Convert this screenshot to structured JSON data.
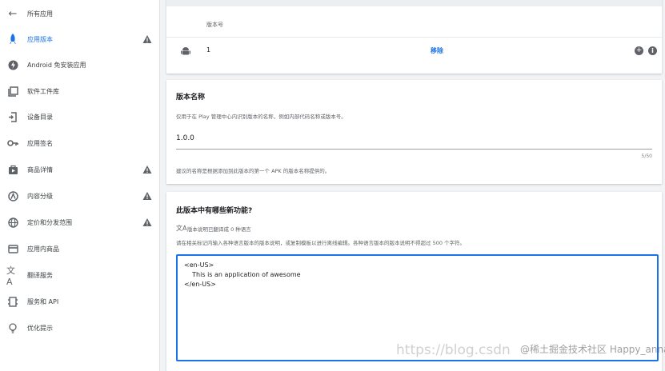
{
  "sidebar": {
    "items": [
      {
        "label": "所有应用",
        "icon": "arrow-back-icon"
      },
      {
        "label": "应用版本",
        "icon": "rocket-icon",
        "active": true,
        "warning": true
      },
      {
        "label": "Android 免安装应用",
        "icon": "instant-app-icon"
      },
      {
        "label": "软件工件库",
        "icon": "library-icon"
      },
      {
        "label": "设备目录",
        "icon": "device-catalog-icon"
      },
      {
        "label": "应用签名",
        "icon": "key-icon"
      },
      {
        "label": "商品详情",
        "icon": "store-listing-icon",
        "warning": true
      },
      {
        "label": "内容分级",
        "icon": "content-rating-icon",
        "warning": true
      },
      {
        "label": "定价和分发范围",
        "icon": "globe-icon",
        "warning": true
      },
      {
        "label": "应用内商品",
        "icon": "card-icon"
      },
      {
        "label": "翻译服务",
        "icon": "translate-icon"
      },
      {
        "label": "服务和 API",
        "icon": "api-icon"
      },
      {
        "label": "优化提示",
        "icon": "lightbulb-icon"
      }
    ]
  },
  "version_table": {
    "column_header": "版本号",
    "row": {
      "version_code": "1",
      "remove_label": "移除",
      "icons": [
        "android-icon",
        "add-circle-icon",
        "info-icon"
      ]
    }
  },
  "release_name": {
    "title": "版本名称",
    "description": "仅用于在 Play 管理中心内识别版本的名称，例如内部代码名称或版本号。",
    "value": "1.0.0",
    "counter": "5/50",
    "hint": "建议的名称是根据添加到此版本的第一个 APK 的版本名称提供的。"
  },
  "release_notes": {
    "title": "此版本中有哪些新功能?",
    "translation_status": "版本说明已翻译成 0 种语言",
    "description": "请在相关标记内输入各种语言版本的版本说明，或复制模板以进行离线编辑。各种语言版本的版本说明不得超过 500 个字符。",
    "text": "<en-US>\n    This is an application of awesome\n</en-US>"
  },
  "watermark": {
    "text": "https://blog.csdn",
    "overlay": "@稀土掘金技术社区 Happy_annan"
  },
  "colors": {
    "accent": "#1a73e8",
    "warning": "#5f6368",
    "background": "#f1f3f4"
  }
}
